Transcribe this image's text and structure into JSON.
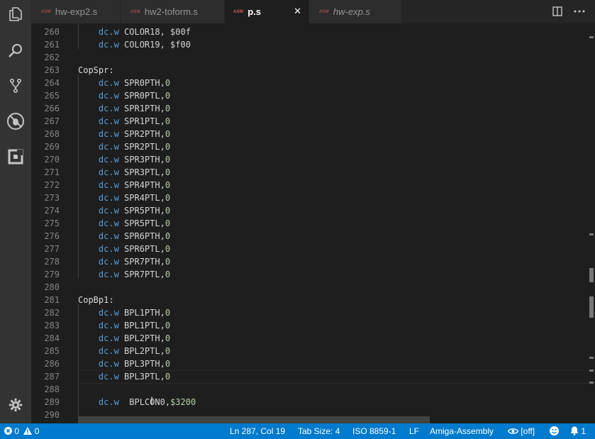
{
  "tabs": [
    {
      "badge": "ASM",
      "label": "hw-exp2.s",
      "active": false,
      "italic": false
    },
    {
      "badge": "ASM",
      "label": "hw2-toform.s",
      "active": false,
      "italic": false
    },
    {
      "badge": "ASM",
      "label": "p.s",
      "active": true,
      "italic": false
    },
    {
      "badge": "ASM",
      "label": "hw-exp.s",
      "active": false,
      "italic": true
    }
  ],
  "tab_close_glyph": "✕",
  "lines": [
    {
      "n": "260",
      "parts": [
        [
          "    ",
          "t"
        ],
        [
          "dc.w",
          "k"
        ],
        [
          " COLOR18, $00f",
          "t"
        ]
      ]
    },
    {
      "n": "261",
      "parts": [
        [
          "    ",
          "t"
        ],
        [
          "dc.w",
          "k"
        ],
        [
          " COLOR19, $f00",
          "t"
        ]
      ]
    },
    {
      "n": "262",
      "parts": []
    },
    {
      "n": "263",
      "parts": [
        [
          "CopSpr:",
          "l"
        ]
      ]
    },
    {
      "n": "264",
      "parts": [
        [
          "    ",
          "t"
        ],
        [
          "dc.w",
          "k"
        ],
        [
          " SPR0PTH,",
          "t"
        ],
        [
          "0",
          "n"
        ]
      ]
    },
    {
      "n": "265",
      "parts": [
        [
          "    ",
          "t"
        ],
        [
          "dc.w",
          "k"
        ],
        [
          " SPR0PTL,",
          "t"
        ],
        [
          "0",
          "n"
        ]
      ]
    },
    {
      "n": "266",
      "parts": [
        [
          "    ",
          "t"
        ],
        [
          "dc.w",
          "k"
        ],
        [
          " SPR1PTH,",
          "t"
        ],
        [
          "0",
          "n"
        ]
      ]
    },
    {
      "n": "267",
      "parts": [
        [
          "    ",
          "t"
        ],
        [
          "dc.w",
          "k"
        ],
        [
          " SPR1PTL,",
          "t"
        ],
        [
          "0",
          "n"
        ]
      ]
    },
    {
      "n": "268",
      "parts": [
        [
          "    ",
          "t"
        ],
        [
          "dc.w",
          "k"
        ],
        [
          " SPR2PTH,",
          "t"
        ],
        [
          "0",
          "n"
        ]
      ]
    },
    {
      "n": "269",
      "parts": [
        [
          "    ",
          "t"
        ],
        [
          "dc.w",
          "k"
        ],
        [
          " SPR2PTL,",
          "t"
        ],
        [
          "0",
          "n"
        ]
      ]
    },
    {
      "n": "270",
      "parts": [
        [
          "    ",
          "t"
        ],
        [
          "dc.w",
          "k"
        ],
        [
          " SPR3PTH,",
          "t"
        ],
        [
          "0",
          "n"
        ]
      ]
    },
    {
      "n": "271",
      "parts": [
        [
          "    ",
          "t"
        ],
        [
          "dc.w",
          "k"
        ],
        [
          " SPR3PTL,",
          "t"
        ],
        [
          "0",
          "n"
        ]
      ]
    },
    {
      "n": "272",
      "parts": [
        [
          "    ",
          "t"
        ],
        [
          "dc.w",
          "k"
        ],
        [
          " SPR4PTH,",
          "t"
        ],
        [
          "0",
          "n"
        ]
      ]
    },
    {
      "n": "273",
      "parts": [
        [
          "    ",
          "t"
        ],
        [
          "dc.w",
          "k"
        ],
        [
          " SPR4PTL,",
          "t"
        ],
        [
          "0",
          "n"
        ]
      ]
    },
    {
      "n": "274",
      "parts": [
        [
          "    ",
          "t"
        ],
        [
          "dc.w",
          "k"
        ],
        [
          " SPR5PTH,",
          "t"
        ],
        [
          "0",
          "n"
        ]
      ]
    },
    {
      "n": "275",
      "parts": [
        [
          "    ",
          "t"
        ],
        [
          "dc.w",
          "k"
        ],
        [
          " SPR5PTL,",
          "t"
        ],
        [
          "0",
          "n"
        ]
      ]
    },
    {
      "n": "276",
      "parts": [
        [
          "    ",
          "t"
        ],
        [
          "dc.w",
          "k"
        ],
        [
          " SPR6PTH,",
          "t"
        ],
        [
          "0",
          "n"
        ]
      ]
    },
    {
      "n": "277",
      "parts": [
        [
          "    ",
          "t"
        ],
        [
          "dc.w",
          "k"
        ],
        [
          " SPR6PTL,",
          "t"
        ],
        [
          "0",
          "n"
        ]
      ]
    },
    {
      "n": "278",
      "parts": [
        [
          "    ",
          "t"
        ],
        [
          "dc.w",
          "k"
        ],
        [
          " SPR7PTH,",
          "t"
        ],
        [
          "0",
          "n"
        ]
      ]
    },
    {
      "n": "279",
      "parts": [
        [
          "    ",
          "t"
        ],
        [
          "dc.w",
          "k"
        ],
        [
          " SPR7PTL,",
          "t"
        ],
        [
          "0",
          "n"
        ]
      ]
    },
    {
      "n": "280",
      "parts": []
    },
    {
      "n": "281",
      "parts": [
        [
          "CopBp1:",
          "l"
        ]
      ]
    },
    {
      "n": "282",
      "parts": [
        [
          "    ",
          "t"
        ],
        [
          "dc.w",
          "k"
        ],
        [
          " BPL1PTH,",
          "t"
        ],
        [
          "0",
          "n"
        ]
      ]
    },
    {
      "n": "283",
      "parts": [
        [
          "    ",
          "t"
        ],
        [
          "dc.w",
          "k"
        ],
        [
          " BPL1PTL,",
          "t"
        ],
        [
          "0",
          "n"
        ]
      ]
    },
    {
      "n": "284",
      "parts": [
        [
          "    ",
          "t"
        ],
        [
          "dc.w",
          "k"
        ],
        [
          " BPL2PTH,",
          "t"
        ],
        [
          "0",
          "n"
        ]
      ]
    },
    {
      "n": "285",
      "parts": [
        [
          "    ",
          "t"
        ],
        [
          "dc.w",
          "k"
        ],
        [
          " BPL2PTL,",
          "t"
        ],
        [
          "0",
          "n"
        ]
      ]
    },
    {
      "n": "286",
      "parts": [
        [
          "    ",
          "t"
        ],
        [
          "dc.w",
          "k"
        ],
        [
          " BPL3PTH,",
          "t"
        ],
        [
          "0",
          "n"
        ]
      ]
    },
    {
      "n": "287",
      "parts": [
        [
          "    ",
          "t"
        ],
        [
          "dc.w",
          "k"
        ],
        [
          " BPL3PTL,",
          "t"
        ],
        [
          "0",
          "n"
        ]
      ]
    },
    {
      "n": "288",
      "parts": []
    },
    {
      "n": "289",
      "parts": [
        [
          "    ",
          "t"
        ],
        [
          "dc.w",
          "k"
        ],
        [
          "  BPLCON0,",
          "t"
        ],
        [
          "$3200",
          "n"
        ]
      ]
    },
    {
      "n": "290",
      "parts": []
    }
  ],
  "status": {
    "errors": "0",
    "warnings": "0",
    "position": "Ln 287, Col 19",
    "tab_size": "Tab Size: 4",
    "encoding": "ISO 8859-1",
    "eol": "LF",
    "language": "Amiga-Assembly",
    "preview": "[off]",
    "notifications": "1"
  },
  "colors": {
    "status_bar": "#007acc",
    "keyword": "#569cd6",
    "number": "#b5cea8",
    "editor_bg": "#1e1e1e"
  }
}
